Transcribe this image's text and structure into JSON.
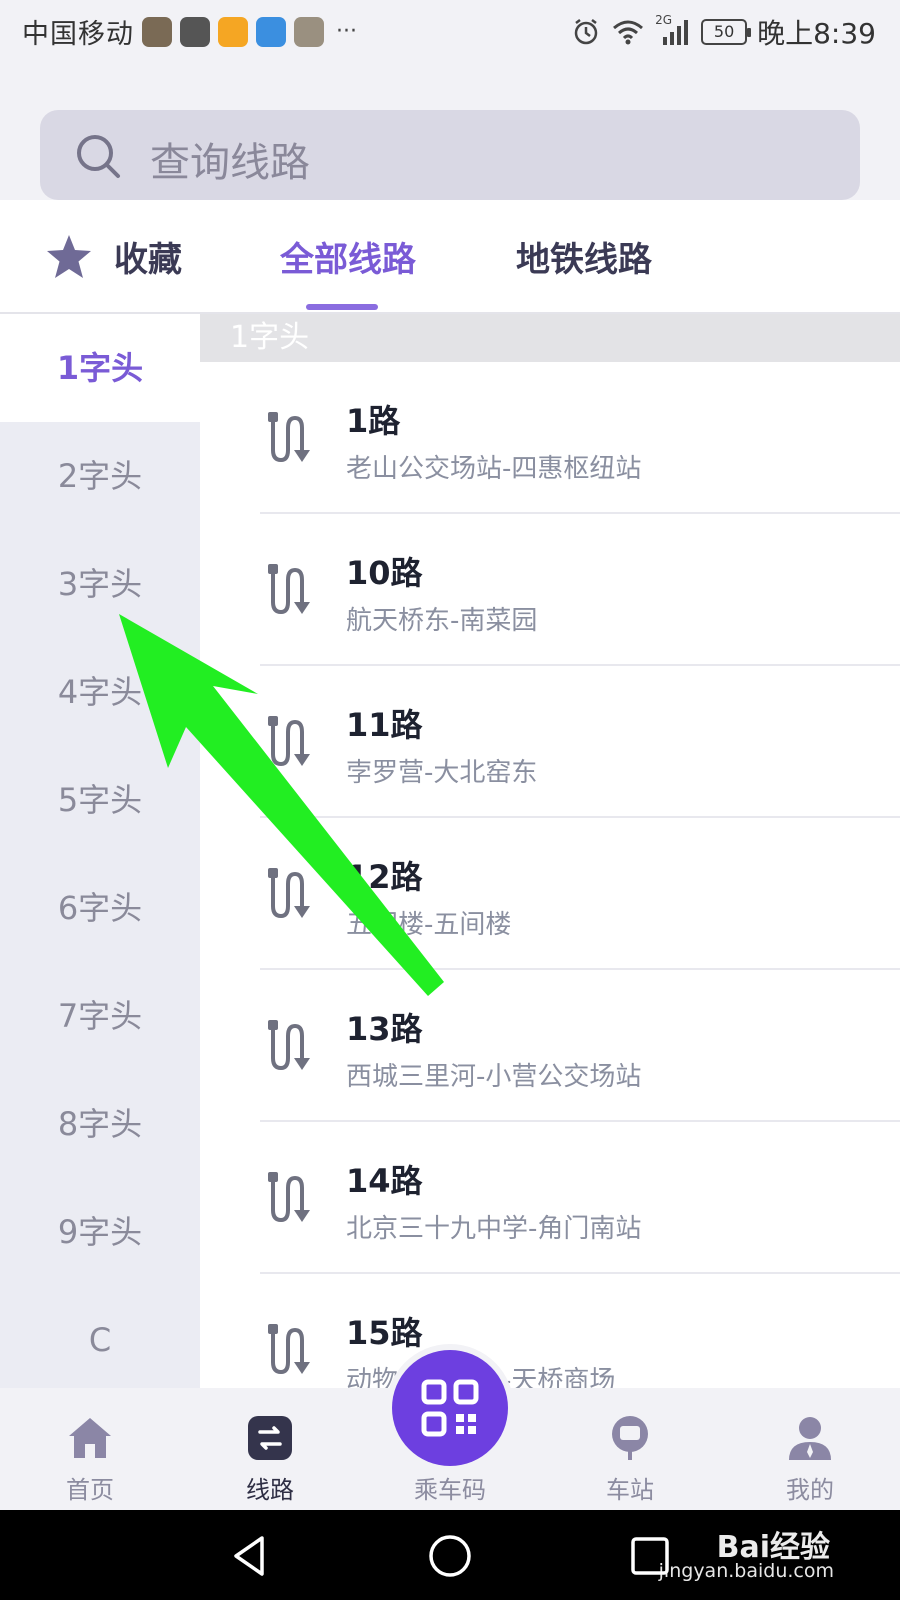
{
  "status_bar": {
    "carrier": "中国移动",
    "network": "2G",
    "battery": "50",
    "time": "晚上8:39"
  },
  "search": {
    "placeholder": "查询线路"
  },
  "tabs": [
    {
      "label": "收藏",
      "icon": "star-icon"
    },
    {
      "label": "全部线路",
      "active": true
    },
    {
      "label": "地铁线路"
    }
  ],
  "index": [
    {
      "label": "1字头",
      "active": true
    },
    {
      "label": "2字头"
    },
    {
      "label": "3字头"
    },
    {
      "label": "4字头"
    },
    {
      "label": "5字头"
    },
    {
      "label": "6字头"
    },
    {
      "label": "7字头"
    },
    {
      "label": "8字头"
    },
    {
      "label": "9字头"
    },
    {
      "label": "C"
    }
  ],
  "group_header": "1字头",
  "routes": [
    {
      "name": "1路",
      "stops": "老山公交场站-四惠枢纽站"
    },
    {
      "name": "10路",
      "stops": "航天桥东-南菜园"
    },
    {
      "name": "11路",
      "stops": "孛罗营-大北窑东"
    },
    {
      "name": "12路",
      "stops": "五间楼-五间楼"
    },
    {
      "name": "13路",
      "stops": "西城三里河-小营公交场站"
    },
    {
      "name": "14路",
      "stops": "北京三十九中学-角门南站"
    },
    {
      "name": "15路",
      "stops": "动物园枢纽站-天桥商场"
    }
  ],
  "bottom_nav": [
    {
      "label": "首页",
      "icon": "home-icon"
    },
    {
      "label": "线路",
      "icon": "route-icon",
      "active": true
    },
    {
      "label": "乘车码",
      "icon": "qr-code-icon"
    },
    {
      "label": "车站",
      "icon": "bus-stop-icon"
    },
    {
      "label": "我的",
      "icon": "user-icon"
    }
  ],
  "watermark": {
    "logo": "Bai经验",
    "url": "jingyan.baidu.com"
  },
  "colors": {
    "accent": "#7a5bd6",
    "qr_button": "#6d3fe0",
    "annotation_arrow": "#22ee22"
  }
}
